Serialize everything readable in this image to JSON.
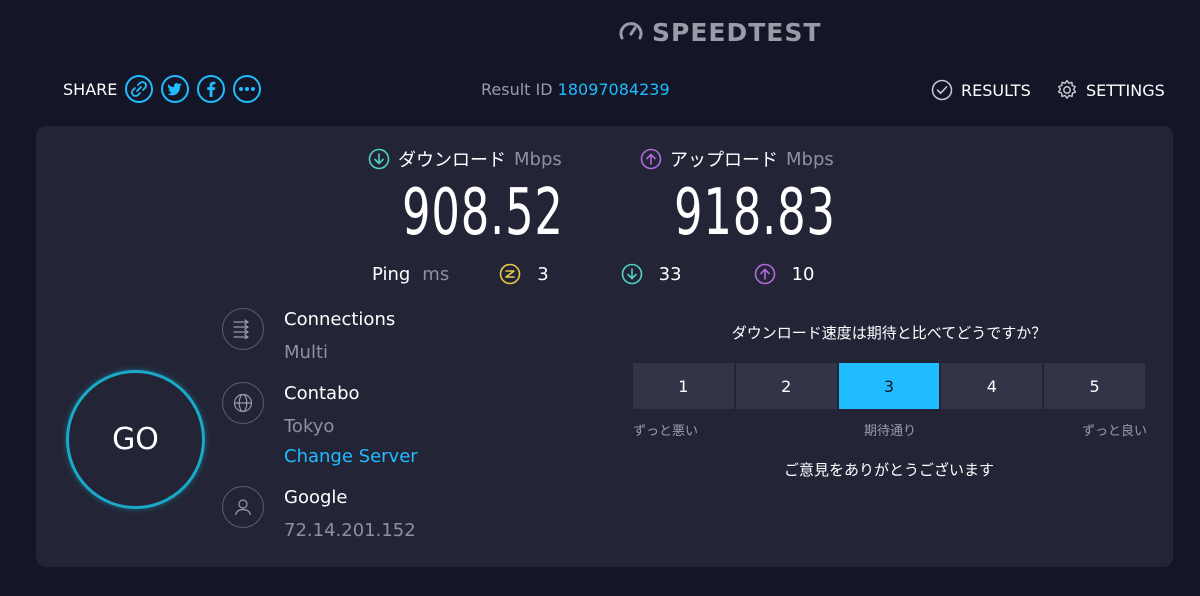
{
  "header": {
    "logo_text": "SPEEDTEST",
    "share_label": "SHARE",
    "social": [
      "link-icon",
      "twitter-icon",
      "facebook-icon",
      "more-icon"
    ],
    "result_id_label": "Result ID",
    "result_id_value": "18097084239",
    "nav": {
      "results": "RESULTS",
      "settings": "SETTINGS"
    }
  },
  "metrics": {
    "download": {
      "label": "ダウンロード",
      "unit": "Mbps",
      "value": "908.52",
      "color": "#4fd1c5"
    },
    "upload": {
      "label": "アップロード",
      "unit": "Mbps",
      "value": "918.83",
      "color": "#b06ad9"
    }
  },
  "ping": {
    "label": "Ping",
    "unit": "ms",
    "idle": "3",
    "download": "33",
    "upload": "10"
  },
  "go_label": "GO",
  "info": {
    "connections": {
      "title": "Connections",
      "value": "Multi"
    },
    "server": {
      "title": "Contabo",
      "value": "Tokyo",
      "change": "Change Server"
    },
    "isp": {
      "title": "Google",
      "value": "72.14.201.152"
    }
  },
  "survey": {
    "question": "ダウンロード速度は期待と比べてどうですか？",
    "options": [
      "1",
      "2",
      "3",
      "4",
      "5"
    ],
    "selected": "3",
    "label_low": "ずっと悪い",
    "label_mid": "期待通り",
    "label_high": "ずっと良い",
    "thanks": "ご意見をありがとうございます"
  },
  "colors": {
    "accent": "#1fbcff",
    "background": "#141526",
    "card": "#232537",
    "ping_idle": "#e9c946"
  }
}
